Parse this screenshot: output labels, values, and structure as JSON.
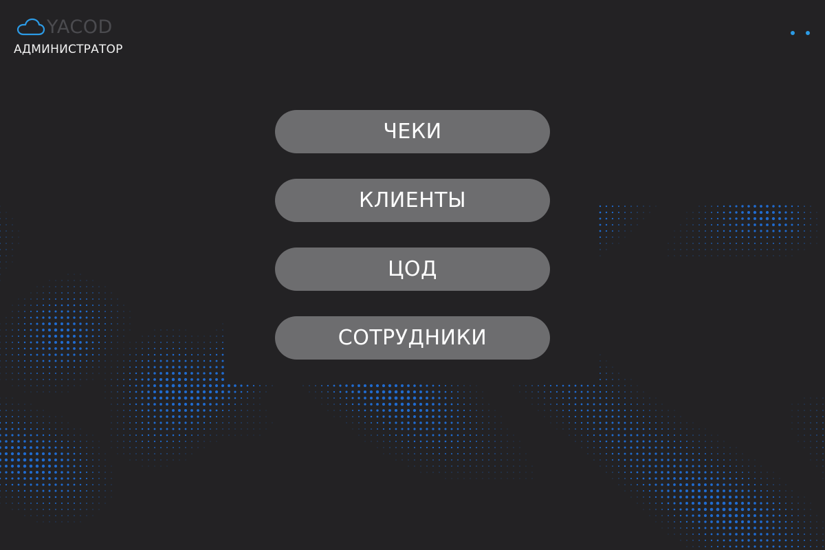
{
  "app": {
    "brand": "YACOD",
    "role": "АДМИНИСТРАТОР"
  },
  "menu": {
    "items": [
      {
        "label": "ЧЕКИ"
      },
      {
        "label": "КЛИЕНТЫ"
      },
      {
        "label": "ЦОД"
      },
      {
        "label": "СОТРУДНИКИ"
      }
    ]
  },
  "colors": {
    "background": "#232224",
    "button": "#6d6d6f",
    "accent": "#2c9be6",
    "wave": "#1f6bd0"
  },
  "icons": {
    "logo": "cloud-icon",
    "menu": "more-dots-icon"
  }
}
